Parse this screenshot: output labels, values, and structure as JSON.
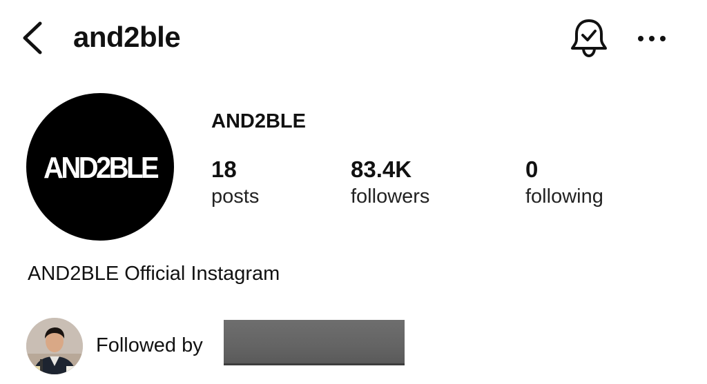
{
  "header": {
    "title": "and2ble",
    "back_icon": "chevron-left-icon",
    "bell_icon": "bell-check-icon",
    "more_icon": "more-horizontal-icon"
  },
  "profile": {
    "avatar_logo_text": "AND2BLE",
    "name": "AND2BLE",
    "stats": {
      "posts": {
        "value": "18",
        "label": "posts"
      },
      "followers": {
        "value": "83.4K",
        "label": "followers"
      },
      "following": {
        "value": "0",
        "label": "following"
      }
    },
    "bio": "AND2BLE Official Instagram"
  },
  "followed_by": {
    "label": "Followed by"
  },
  "colors": {
    "background": "#ffffff",
    "text": "#111111",
    "avatar_bg": "#000000",
    "redacted": "#666666"
  }
}
